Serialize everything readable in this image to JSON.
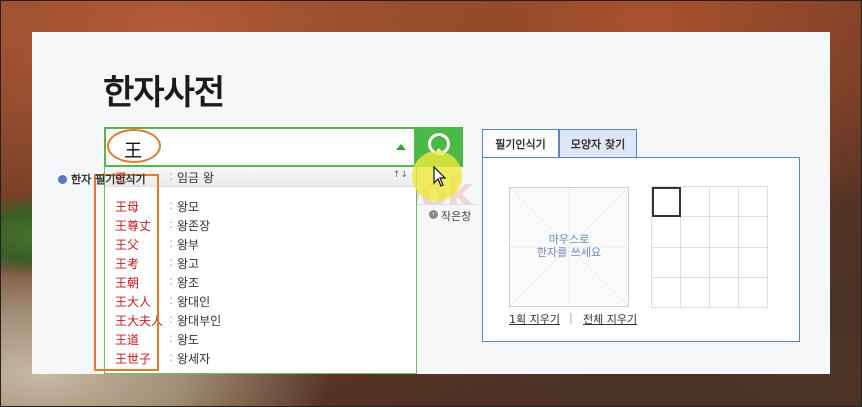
{
  "page": {
    "title": "한자사전"
  },
  "search": {
    "query": "王",
    "button_label": "검색"
  },
  "small_window": {
    "label": "작은창"
  },
  "watermark": {
    "text": "Book"
  },
  "suggestions": {
    "sort_icon": "↑↓",
    "items": [
      {
        "hanja": "王",
        "meaning": "임금 왕"
      },
      {
        "hanja": "王母",
        "meaning": "왕모"
      },
      {
        "hanja": "王尊丈",
        "meaning": "왕존장"
      },
      {
        "hanja": "王父",
        "meaning": "왕부"
      },
      {
        "hanja": "王考",
        "meaning": "왕고"
      },
      {
        "hanja": "王朝",
        "meaning": "왕조"
      },
      {
        "hanja": "王大人",
        "meaning": "왕대인"
      },
      {
        "hanja": "王大夫人",
        "meaning": "왕대부인"
      },
      {
        "hanja": "王道",
        "meaning": "왕도"
      },
      {
        "hanja": "王世子",
        "meaning": "왕세자"
      }
    ]
  },
  "tabs": [
    {
      "label": "필기인식기",
      "active": true
    },
    {
      "label": "모양자 찾기",
      "active": false
    }
  ],
  "handwriting": {
    "title": "한자 필기인식기",
    "hint_line1": "마우스로",
    "hint_line2": "한자를 쓰세요",
    "clear_one": "1획 지우기",
    "clear_all": "전체 지우기",
    "grid_cells": 16,
    "selected_cell": 0
  },
  "colors": {
    "accent_green": "#4cb848",
    "annotation_orange": "#e07b2e",
    "hanja_red": "#c31b1b",
    "tab_blue": "#5b84c4"
  }
}
